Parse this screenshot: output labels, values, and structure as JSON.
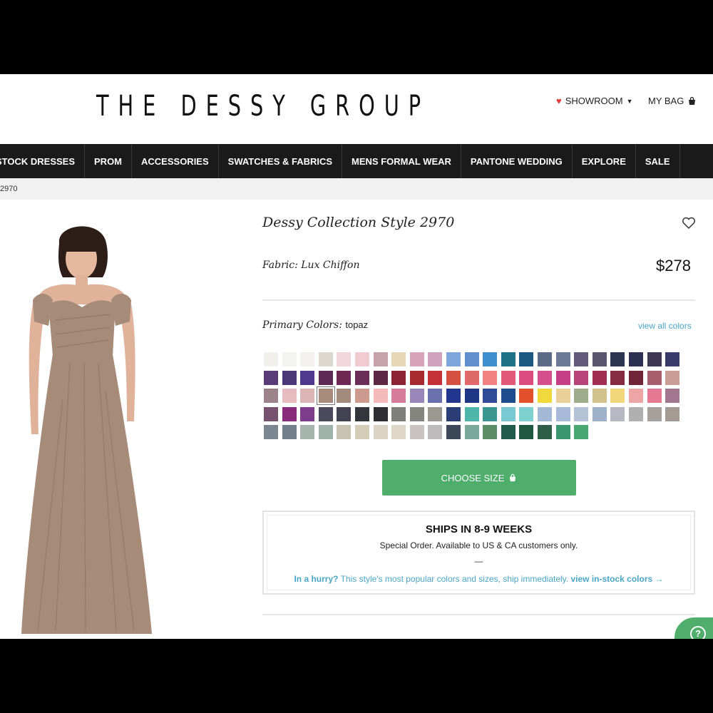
{
  "header": {
    "logo": "THE DESSY GROUP",
    "showroom_label": "SHOWROOM",
    "bag_label": "MY BAG"
  },
  "nav": {
    "items": [
      "STOCK DRESSES",
      "PROM",
      "ACCESSORIES",
      "SWATCHES & FABRICS",
      "MENS FORMAL WEAR",
      "PANTONE WEDDING",
      "EXPLORE",
      "SALE"
    ]
  },
  "breadcrumb": "2970",
  "product": {
    "title": "Dessy Collection Style 2970",
    "fabric": "Fabric: Lux Chiffon",
    "price": "$278",
    "primary_colors_label": "Primary Colors:",
    "selected_color": "topaz",
    "view_all_label": "view all colors",
    "choose_size_label": "CHOOSE SIZE",
    "swatches": [
      [
        "#f1f0ec",
        "#f3f3f0",
        "#f3f1ee",
        "#dcd7cf",
        "#f2d7dc",
        "#f0cbd2",
        "#c7a3ab",
        "#e7d6b8",
        "#d8a3b8",
        "#cfa3bd",
        "#7fa7dc",
        "#5f8fcf",
        "#3f8fce",
        "#1e7389",
        "#1d5a82",
        "#5c6c86",
        "#6c7a95",
        "#635a7b",
        "#5b5670",
        "#2c3550",
        "#2b3150",
        "#3d3755",
        "#39396a"
      ],
      [
        "#5a3b7a",
        "#4a3777",
        "#4d3a8f",
        "#5e2a55",
        "#6e2653",
        "#6a2e58",
        "#5c2745",
        "#8a2435",
        "#a82a31",
        "#c43235",
        "#d45040",
        "#e06a6a",
        "#f28181",
        "#e35a78",
        "#d94c7d",
        "#d44f8c",
        "#c43f87",
        "#b8427a",
        "#a22e53",
        "#872b45",
        "#6f2437",
        "#a85f6d",
        "#c99e95"
      ],
      [
        "#9c838a",
        "#e6bcc0",
        "#dcb5b6",
        "#a78c7b",
        "#a38a7c",
        "#cc9a8e",
        "#f4b9b9",
        "#d77c9a",
        "#9a87b9",
        "#6a71ad",
        "#22368f",
        "#1f3585",
        "#2f4a96",
        "#1d4d8f",
        "#e2502c",
        "#f0d93c",
        "#e9cf98",
        "#9fac8b",
        "#d2c28b",
        "#f2d67a",
        "#eda5a5",
        "#e57892",
        "#a37790"
      ],
      [
        "#77526e",
        "#892a7a",
        "#7d3c8c",
        "#4a4a5c",
        "#424250",
        "#35353d",
        "#2e2e33",
        "#7e7e7a",
        "#858580",
        "#9a9890",
        "#2a3e75",
        "#4eb5a9",
        "#3b968f",
        "#79c9d4",
        "#7dd1d0",
        "#a3b8d6",
        "#a7bbd9",
        "#b5c3d6",
        "#9eb1c8",
        "#b8b8c2",
        "#b0b0b0",
        "#a6a19c",
        "#a49c94"
      ],
      [
        "#7a8690",
        "#72808a",
        "#a6b6ad",
        "#9fb3aa",
        "#c9c3b2",
        "#d6cdb8",
        "#ddd3c5",
        "#e0d6c8",
        "#c9c4c1",
        "#bfbbbd",
        "#3c4858",
        "#7aa89a",
        "#5c8c63",
        "#1f5c4b",
        "#1e5841",
        "#2e5e47",
        "#3a9571",
        "#4aa970"
      ]
    ],
    "selected_swatch_row": 2,
    "selected_swatch_col": 3
  },
  "shipping": {
    "title": "SHIPS IN 8-9 WEEKS",
    "subtitle": "Special Order. Available to US & CA customers only.",
    "dash": "—",
    "hurry_label": "In a hurry?",
    "hurry_text": " This style's most popular colors and sizes, ship immediately. ",
    "instock_label": "view in-stock colors →"
  },
  "colors": {
    "accent_green": "#4fae6b",
    "link_blue": "#4aa6c6",
    "nav_bg": "#1a1a1a",
    "dress": "#a68b78"
  }
}
